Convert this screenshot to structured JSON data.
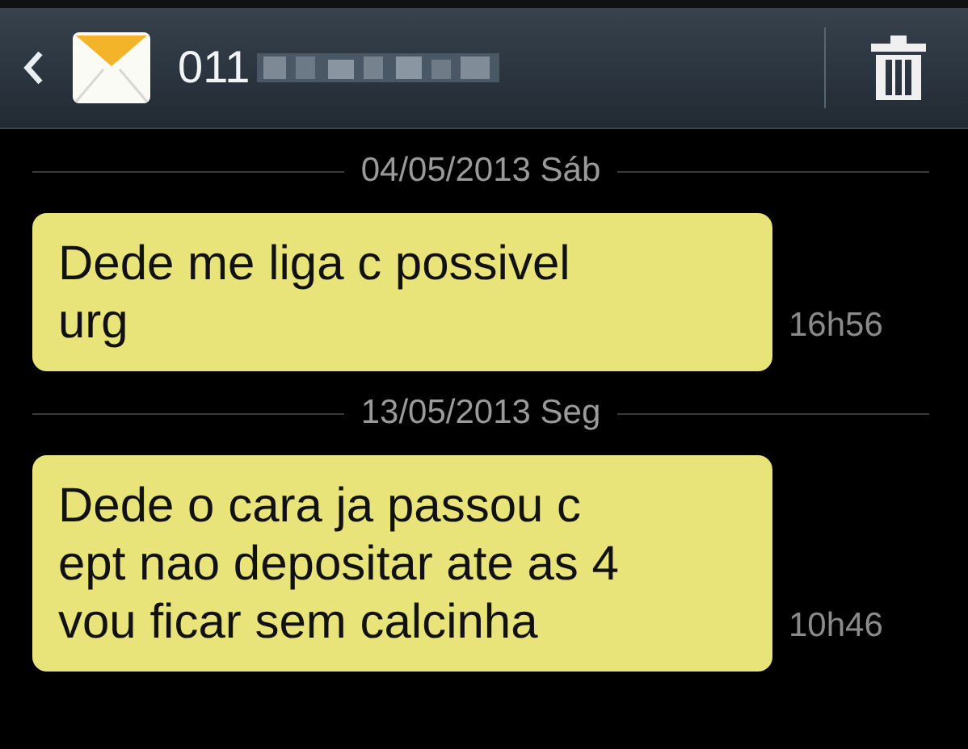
{
  "header": {
    "contact": "011"
  },
  "days": [
    {
      "date": "04/05/2013 Sáb",
      "messages": [
        {
          "text": "Dede me liga c possivel\nurg",
          "time": "16h56"
        }
      ]
    },
    {
      "date": "13/05/2013 Seg",
      "messages": [
        {
          "text": "Dede o cara ja passou c\nept nao depositar ate as 4\nvou ficar sem calcinha",
          "time": "10h46"
        }
      ]
    }
  ]
}
